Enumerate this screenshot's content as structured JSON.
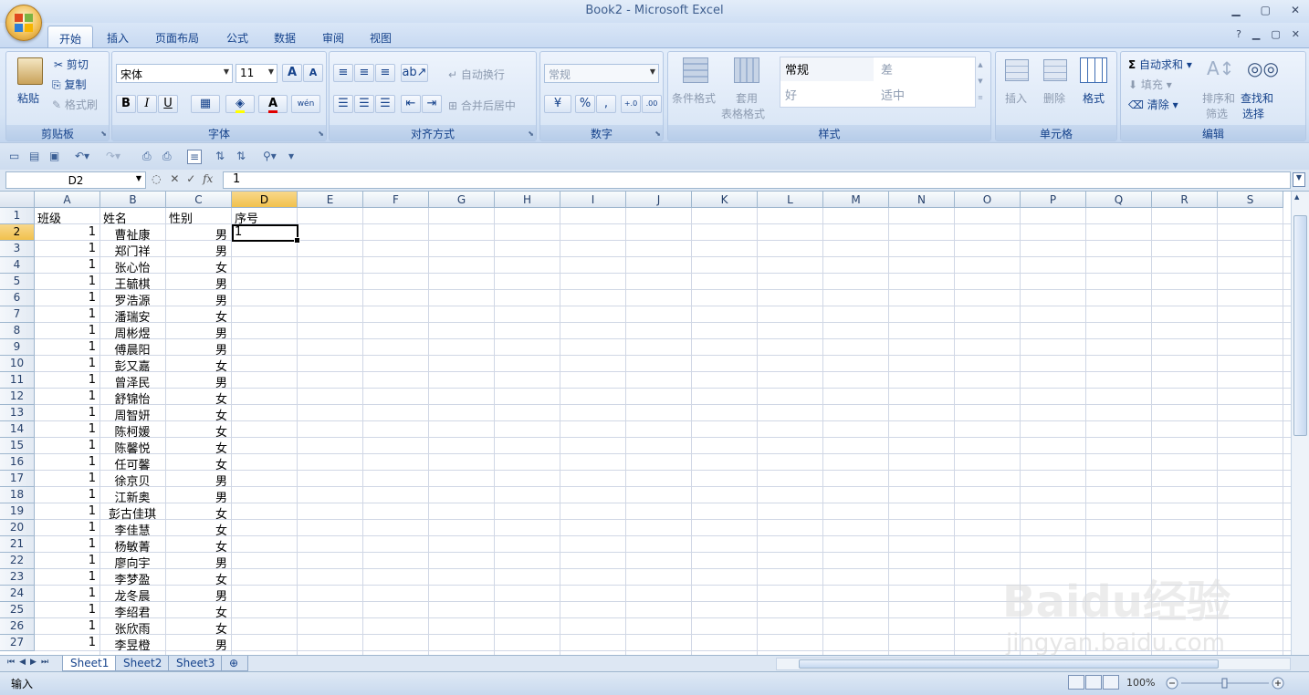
{
  "window": {
    "title": "Book2 - Microsoft Excel"
  },
  "tabs": [
    "开始",
    "插入",
    "页面布局",
    "公式",
    "数据",
    "审阅",
    "视图"
  ],
  "active_tab_index": 0,
  "ribbon": {
    "clipboard": {
      "group": "剪贴板",
      "paste": "粘贴",
      "cut": "剪切",
      "copy": "复制",
      "format_painter": "格式刷"
    },
    "font": {
      "group": "字体",
      "font_name": "宋体",
      "font_size": "11",
      "bold": "B",
      "italic": "I",
      "underline": "U",
      "grow": "A",
      "shrink": "A",
      "font_color_letter": "A",
      "phonetic": "wén"
    },
    "alignment": {
      "group": "对齐方式",
      "wrap_text": "自动换行",
      "merge_center": "合并后居中"
    },
    "number": {
      "group": "数字",
      "format": "常规",
      "percent": "%",
      "comma": ",",
      "inc_decimal": "+.0\n.00",
      "dec_decimal": ".00\n→.0"
    },
    "styles": {
      "group": "样式",
      "conditional": "条件格式",
      "table_format_1": "套用",
      "table_format_2": "表格格式",
      "style_normal": "常规",
      "style_bad": "差",
      "style_good": "好",
      "style_neutral": "适中"
    },
    "cells": {
      "group": "单元格",
      "insert": "插入",
      "delete": "删除",
      "format": "格式"
    },
    "editing": {
      "group": "编辑",
      "autosum": "自动求和",
      "fill": "填充",
      "clear": "清除",
      "sort_1": "排序和",
      "sort_2": "筛选",
      "find_1": "查找和",
      "find_2": "选择"
    }
  },
  "formula_bar": {
    "name_box": "D2",
    "value": "1",
    "fx": "fx"
  },
  "columns": [
    "A",
    "B",
    "C",
    "D",
    "E",
    "F",
    "G",
    "H",
    "I",
    "J",
    "K",
    "L",
    "M",
    "N",
    "O",
    "P",
    "Q",
    "R",
    "S"
  ],
  "selected_column": "D",
  "selected_row": 2,
  "rows": [
    {
      "n": "1",
      "a": "班级",
      "b": "姓名",
      "c": "性别",
      "d": "序号"
    },
    {
      "n": "2",
      "a": "1",
      "b": "曹祉康",
      "c": "男",
      "d": "1"
    },
    {
      "n": "3",
      "a": "1",
      "b": "郑门祥",
      "c": "男",
      "d": ""
    },
    {
      "n": "4",
      "a": "1",
      "b": "张心怡",
      "c": "女",
      "d": ""
    },
    {
      "n": "5",
      "a": "1",
      "b": "王毓棋",
      "c": "男",
      "d": ""
    },
    {
      "n": "6",
      "a": "1",
      "b": "罗浩源",
      "c": "男",
      "d": ""
    },
    {
      "n": "7",
      "a": "1",
      "b": "潘瑞安",
      "c": "女",
      "d": ""
    },
    {
      "n": "8",
      "a": "1",
      "b": "周彬煜",
      "c": "男",
      "d": ""
    },
    {
      "n": "9",
      "a": "1",
      "b": "傅晨阳",
      "c": "男",
      "d": ""
    },
    {
      "n": "10",
      "a": "1",
      "b": "彭又嘉",
      "c": "女",
      "d": ""
    },
    {
      "n": "11",
      "a": "1",
      "b": "曾泽民",
      "c": "男",
      "d": ""
    },
    {
      "n": "12",
      "a": "1",
      "b": "舒锦怡",
      "c": "女",
      "d": ""
    },
    {
      "n": "13",
      "a": "1",
      "b": "周智妍",
      "c": "女",
      "d": ""
    },
    {
      "n": "14",
      "a": "1",
      "b": "陈柯媛",
      "c": "女",
      "d": ""
    },
    {
      "n": "15",
      "a": "1",
      "b": "陈馨悦",
      "c": "女",
      "d": ""
    },
    {
      "n": "16",
      "a": "1",
      "b": "任可馨",
      "c": "女",
      "d": ""
    },
    {
      "n": "17",
      "a": "1",
      "b": "徐京贝",
      "c": "男",
      "d": ""
    },
    {
      "n": "18",
      "a": "1",
      "b": "江新奥",
      "c": "男",
      "d": ""
    },
    {
      "n": "19",
      "a": "1",
      "b": "彭古佳琪",
      "c": "女",
      "d": ""
    },
    {
      "n": "20",
      "a": "1",
      "b": "李佳慧",
      "c": "女",
      "d": ""
    },
    {
      "n": "21",
      "a": "1",
      "b": "杨敏菁",
      "c": "女",
      "d": ""
    },
    {
      "n": "22",
      "a": "1",
      "b": "廖向宇",
      "c": "男",
      "d": ""
    },
    {
      "n": "23",
      "a": "1",
      "b": "李梦盈",
      "c": "女",
      "d": ""
    },
    {
      "n": "24",
      "a": "1",
      "b": "龙冬晨",
      "c": "男",
      "d": ""
    },
    {
      "n": "25",
      "a": "1",
      "b": "李绍君",
      "c": "女",
      "d": ""
    },
    {
      "n": "26",
      "a": "1",
      "b": "张欣雨",
      "c": "女",
      "d": ""
    },
    {
      "n": "27",
      "a": "1",
      "b": "李昱橙",
      "c": "男",
      "d": ""
    }
  ],
  "sheets": [
    "Sheet1",
    "Sheet2",
    "Sheet3"
  ],
  "active_sheet": "Sheet1",
  "status": {
    "mode": "输入",
    "zoom": "100%"
  },
  "watermark": {
    "brand": "Baidu经验",
    "url": "jingyan.baidu.com"
  }
}
